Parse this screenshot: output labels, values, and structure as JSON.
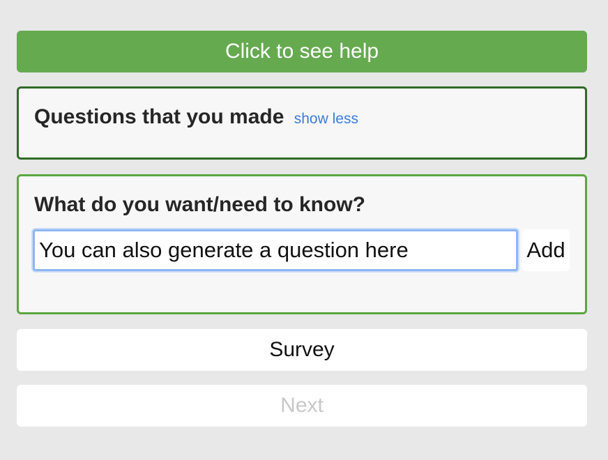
{
  "help": {
    "label": "Click to see help"
  },
  "questions_made": {
    "heading": "Questions that you made",
    "toggle_label": "show less"
  },
  "ask": {
    "heading": "What do you want/need to know?",
    "input_placeholder": "You can also generate a question here",
    "add_label": "Add"
  },
  "survey": {
    "label": "Survey"
  },
  "next": {
    "label": "Next",
    "disabled": true
  },
  "colors": {
    "background": "#e8e8e8",
    "help_green": "#66aa50",
    "made_border": "#2f6b25",
    "ask_border": "#5aa63e",
    "link_blue": "#3b7ddd",
    "disabled_text": "#c8c8c8"
  }
}
